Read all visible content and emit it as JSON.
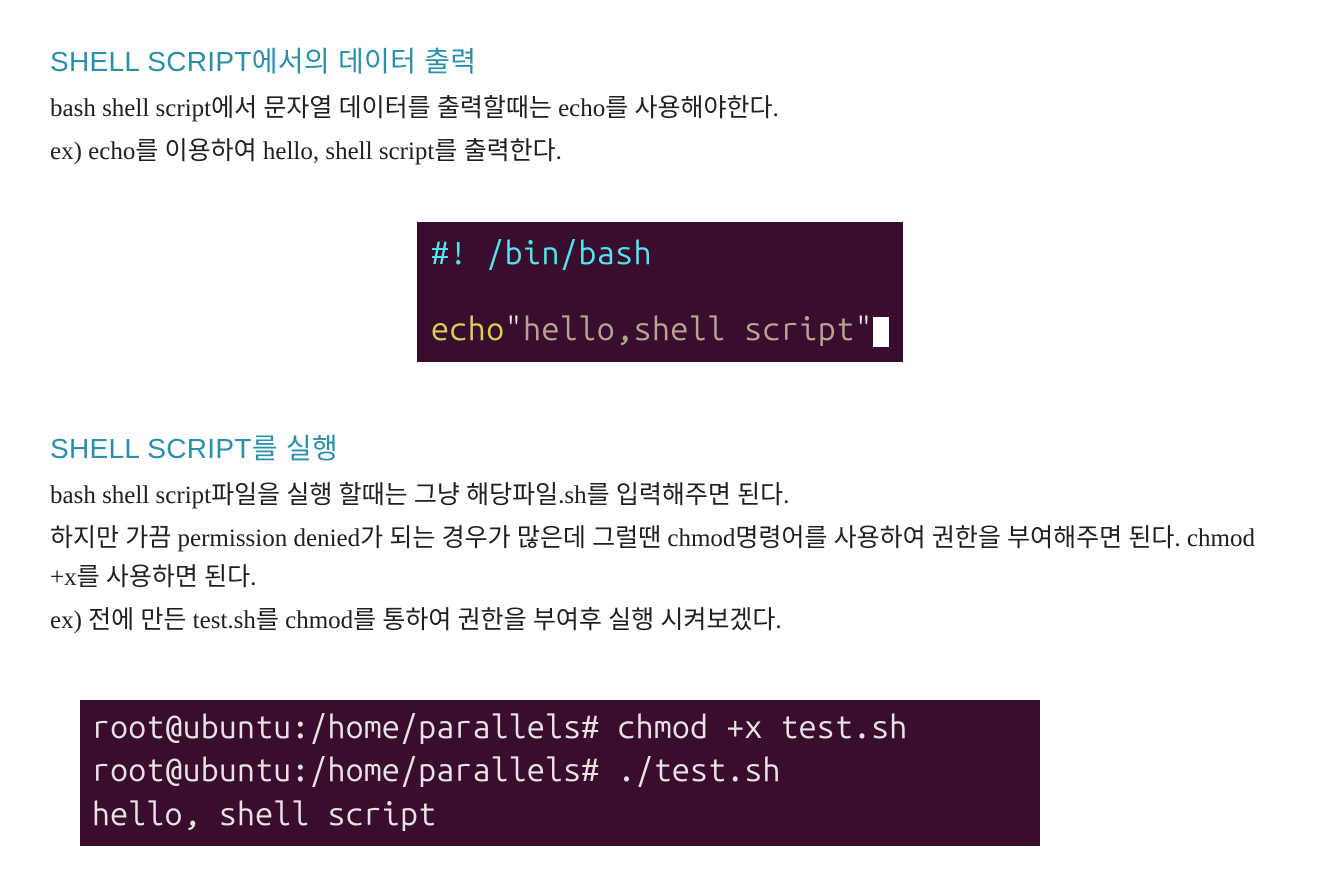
{
  "section1": {
    "heading": "SHELL SCRIPT에서의 데이터 출력",
    "p1": "bash shell script에서 문자열 데이터를 출력할때는 echo를 사용해야한다.",
    "p2": "ex) echo를 이용하여 hello, shell script를 출력한다.",
    "code": {
      "shebang_prefix": "#! ",
      "shebang_path": "/bin/bash",
      "echo_kw": "echo",
      "echo_q1": "\"",
      "echo_str": "hello,shell script",
      "echo_q2": "\""
    }
  },
  "section2": {
    "heading": "SHELL SCRIPT를 실행",
    "p1": "bash shell script파일을 실행 할때는 그냥 해당파일.sh를 입력해주면 된다.",
    "p2": "하지만 가끔 permission denied가 되는 경우가 많은데 그럴땐 chmod명령어를 사용하여 권한을 부여해주면 된다. chmod +x를 사용하면 된다.",
    "p3": "ex) 전에 만든 test.sh를 chmod를 통하여 권한을 부여후 실행 시켜보겠다.",
    "term": {
      "line1": "root@ubuntu:/home/parallels# chmod +x test.sh",
      "line2": "root@ubuntu:/home/parallels# ./test.sh",
      "line3": "hello, shell script"
    }
  }
}
